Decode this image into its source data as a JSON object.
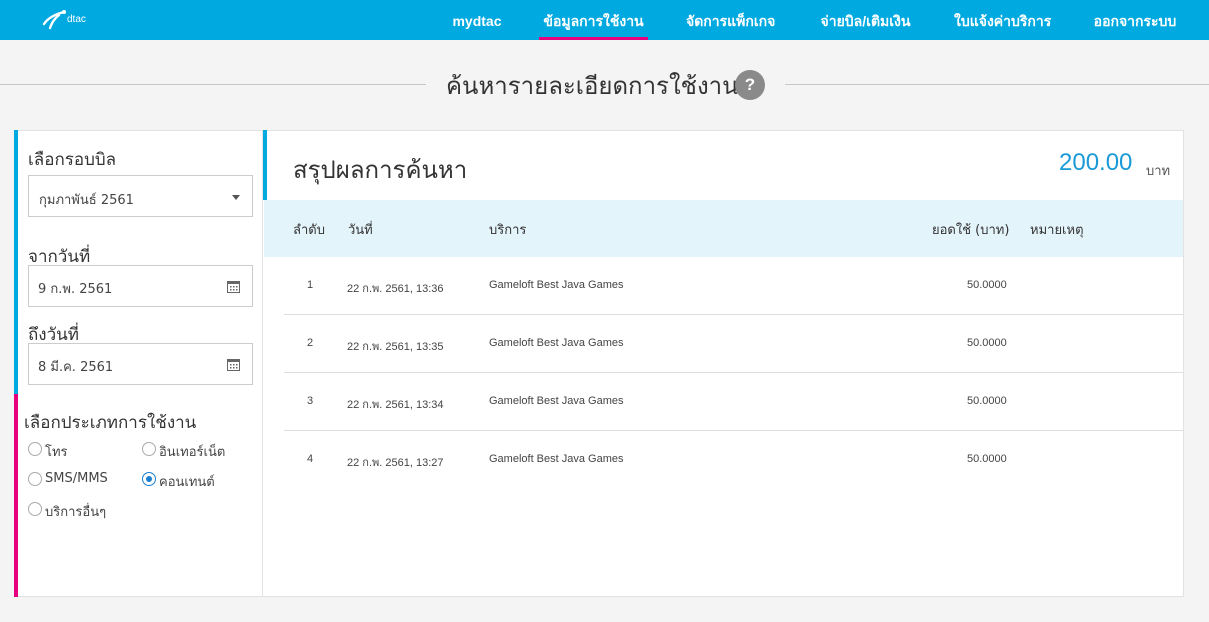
{
  "brand": {
    "logo_text": "dtac"
  },
  "nav": {
    "items": [
      {
        "label": "mydtac"
      },
      {
        "label": "ข้อมูลการใช้งาน"
      },
      {
        "label": "จัดการแพ็กเกจ"
      },
      {
        "label": "จ่ายบิล/เติมเงิน"
      },
      {
        "label": "ใบแจ้งค่าบริการ"
      },
      {
        "label": "ออกจากระบบ"
      }
    ],
    "active_index": 1
  },
  "page": {
    "title": "ค้นหารายละเอียดการใช้งาน",
    "help_icon": "?"
  },
  "filters": {
    "bill_cycle_label": "เลือกรอบบิล",
    "bill_cycle_value": "กุมภาพันธ์ 2561",
    "from_label": "จากวันที่",
    "from_value": "9 ก.พ. 2561",
    "to_label": "ถึงวันที่",
    "to_value": "8 มี.ค. 2561",
    "type_label": "เลือกประเภทการใช้งาน",
    "types": [
      {
        "label": "โทร",
        "checked": false
      },
      {
        "label": "อินเทอร์เน็ต",
        "checked": false
      },
      {
        "label": "SMS/MMS",
        "checked": false
      },
      {
        "label": "คอนเทนต์",
        "checked": true
      },
      {
        "label": "บริการอื่นๆ",
        "checked": false
      }
    ]
  },
  "summary": {
    "title": "สรุปผลการค้นหา",
    "total": "200.00",
    "unit": "บาท",
    "columns": [
      "ลำดับ",
      "วันที่",
      "บริการ",
      "ยอดใช้ (บาท)",
      "หมายเหตุ"
    ],
    "rows": [
      {
        "no": "1",
        "date": "22 ก.พ. 2561, 13:36",
        "service": "Gameloft Best Java Games",
        "amount": "50.0000",
        "note": ""
      },
      {
        "no": "2",
        "date": "22 ก.พ. 2561, 13:35",
        "service": "Gameloft Best Java Games",
        "amount": "50.0000",
        "note": ""
      },
      {
        "no": "3",
        "date": "22 ก.พ. 2561, 13:34",
        "service": "Gameloft Best Java Games",
        "amount": "50.0000",
        "note": ""
      },
      {
        "no": "4",
        "date": "22 ก.พ. 2561, 13:27",
        "service": "Gameloft Best Java Games",
        "amount": "50.0000",
        "note": ""
      }
    ]
  },
  "colors": {
    "brand_blue": "#00a9e0",
    "accent_pink": "#e6007e",
    "amount_blue": "#1a9ad6",
    "header_bg": "#e4f4fb"
  }
}
